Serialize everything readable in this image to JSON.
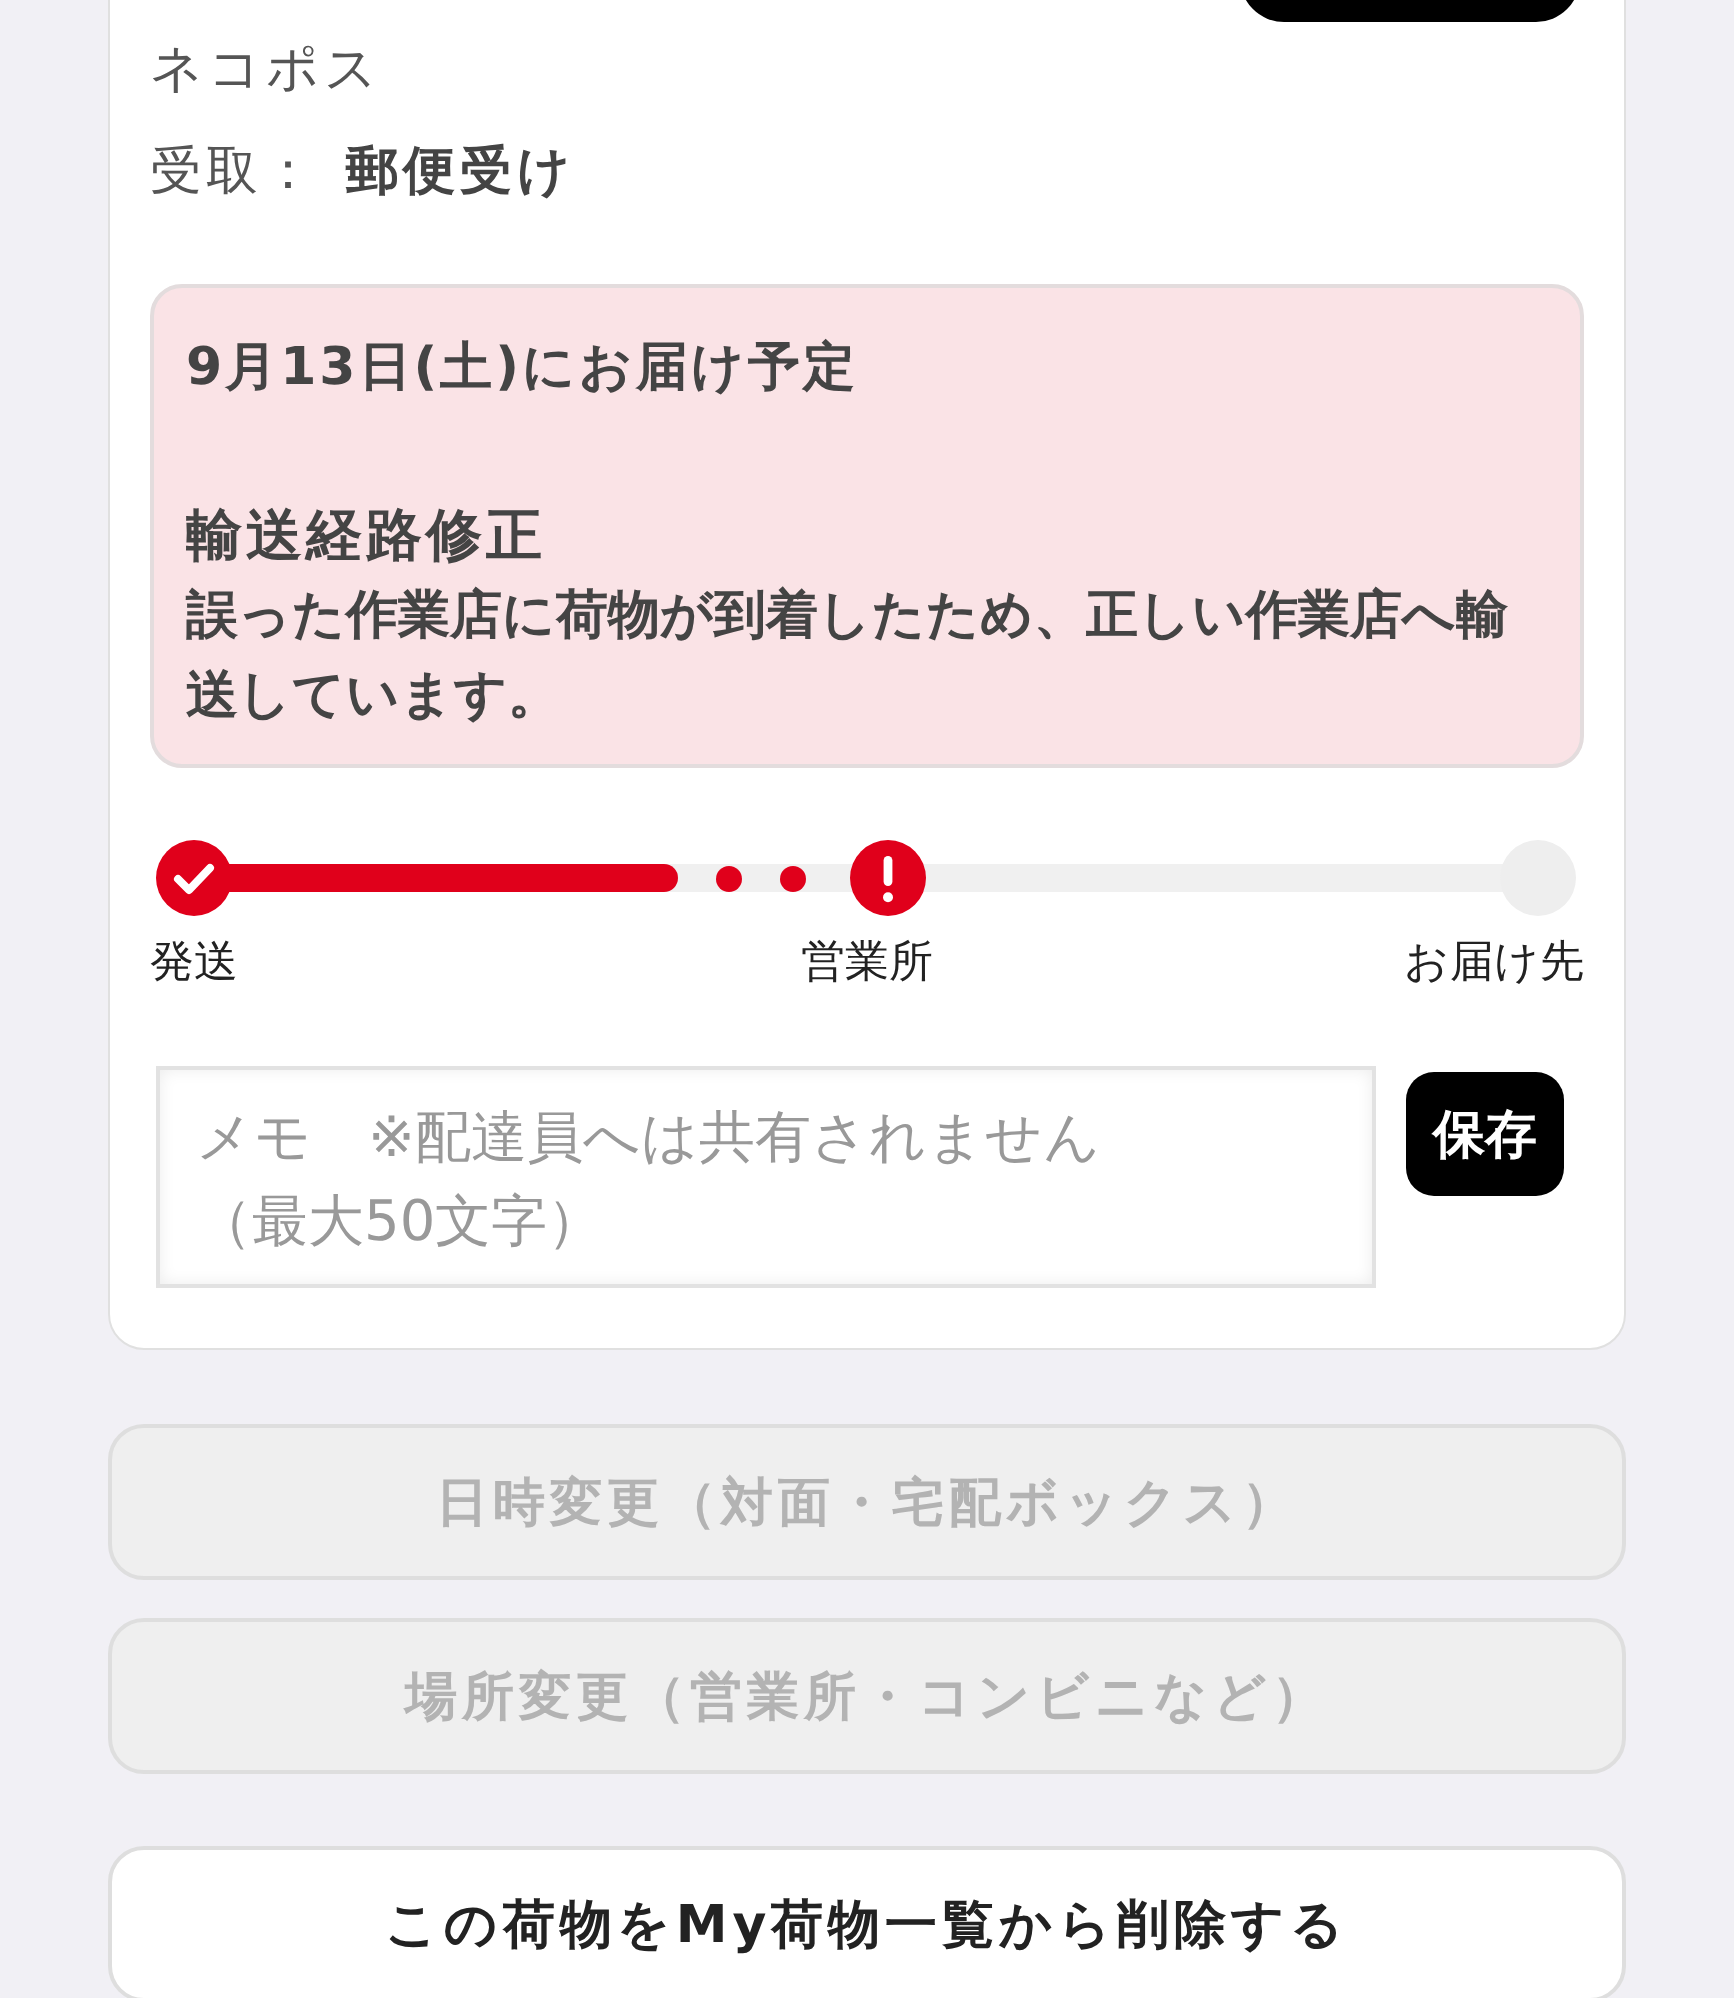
{
  "card": {
    "service": "ネコポス",
    "receipt": {
      "label": "受取：",
      "value": "郵便受け"
    },
    "notice": {
      "title": "9月13日(土)にお届け予定",
      "heading": "輸送経路修正",
      "message": "誤った作業店に荷物が到着したため、正しい作業店へ輸送しています。"
    },
    "steps": [
      {
        "label": "発送",
        "kind": "done"
      },
      {
        "label": "営業所",
        "kind": "alert"
      },
      {
        "label": "お届け先",
        "kind": "pending"
      }
    ],
    "memo": {
      "placeholder": "メモ　※配達員へは共有されません（最大50文字）",
      "save_button": "保存"
    }
  },
  "actions": [
    {
      "label": "日時変更（対面・宅配ボックス）",
      "disabled": true
    },
    {
      "label": "場所変更（営業所・コンビニなど）",
      "disabled": true
    },
    {
      "label": "この荷物をMy荷物一覧から削除する",
      "disabled": false
    }
  ]
}
